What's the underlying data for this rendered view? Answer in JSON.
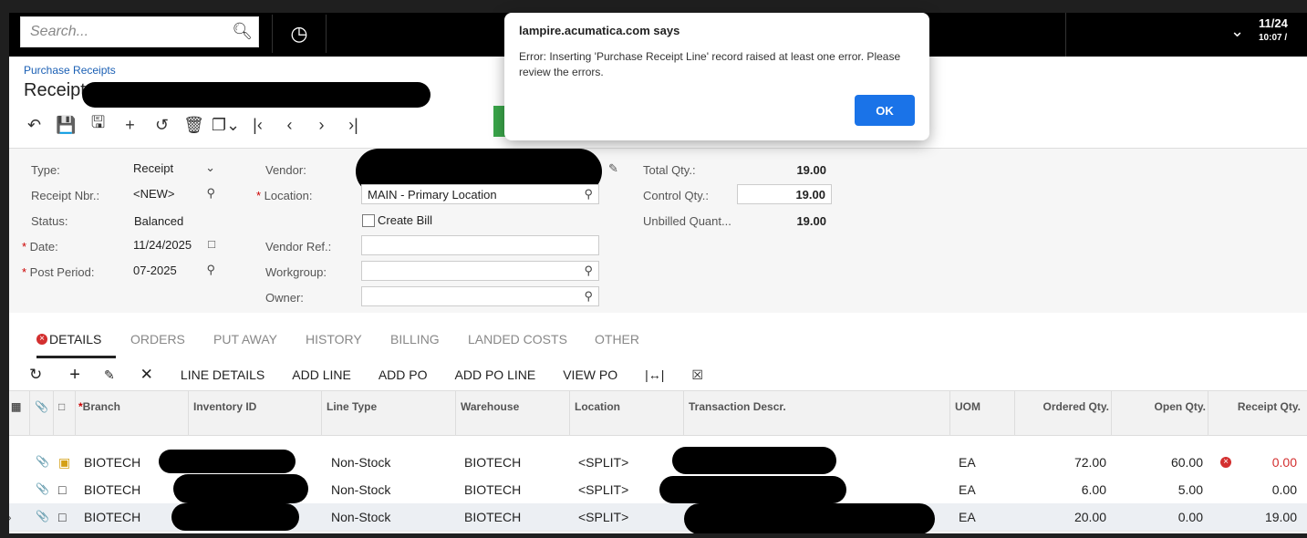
{
  "search": {
    "placeholder": "Search..."
  },
  "topbar": {
    "date": "11/24",
    "time": "10:07 /"
  },
  "header": {
    "breadcrumb": "Purchase Receipts",
    "title": "Receipt"
  },
  "form": {
    "type_label": "Type:",
    "type_value": "Receipt",
    "receipt_nbr_label": "Receipt Nbr.:",
    "receipt_nbr_value": "<NEW>",
    "status_label": "Status:",
    "status_value": "Balanced",
    "date_label": "Date:",
    "date_value": "11/24/2025",
    "post_period_label": "Post Period:",
    "post_period_value": "07-2025",
    "vendor_label": "Vendor:",
    "location_label": "Location:",
    "location_value": "MAIN - Primary Location",
    "create_bill_label": "Create Bill",
    "vendor_ref_label": "Vendor Ref.:",
    "workgroup_label": "Workgroup:",
    "owner_label": "Owner:",
    "total_qty_label": "Total Qty.:",
    "total_qty_value": "19.00",
    "control_qty_label": "Control Qty.:",
    "control_qty_value": "19.00",
    "unbilled_label": "Unbilled Quant...",
    "unbilled_value": "19.00"
  },
  "tabs": [
    "DETAILS",
    "ORDERS",
    "PUT AWAY",
    "HISTORY",
    "BILLING",
    "LANDED COSTS",
    "OTHER"
  ],
  "grid_toolbar": [
    "LINE DETAILS",
    "ADD LINE",
    "ADD PO",
    "ADD PO LINE",
    "VIEW PO"
  ],
  "grid": {
    "headers": [
      "Branch",
      "Inventory ID",
      "Line Type",
      "Warehouse",
      "Location",
      "Transaction Descr.",
      "UOM",
      "Ordered Qty.",
      "Open Qty.",
      "Receipt Qty."
    ],
    "rows": [
      {
        "branch": "BIOTECH",
        "line_type": "Non-Stock",
        "warehouse": "BIOTECH",
        "location": "<SPLIT>",
        "uom": "EA",
        "ordered": "72.00",
        "open": "60.00",
        "receipt": "0.00"
      },
      {
        "branch": "BIOTECH",
        "line_type": "Non-Stock",
        "warehouse": "BIOTECH",
        "location": "<SPLIT>",
        "uom": "EA",
        "ordered": "6.00",
        "open": "5.00",
        "receipt": "0.00"
      },
      {
        "branch": "BIOTECH",
        "line_type": "Non-Stock",
        "warehouse": "BIOTECH",
        "location": "<SPLIT>",
        "uom": "EA",
        "ordered": "20.00",
        "open": "0.00",
        "receipt": "19.00"
      }
    ]
  },
  "dialog": {
    "title": "lampire.acumatica.com says",
    "message": "Error: Inserting  'Purchase Receipt Line' record raised at least one error. Please review the errors.",
    "ok_label": "OK"
  },
  "colors": {
    "accent": "#1a73e8",
    "error": "#d32f2f",
    "save_green": "#3aa64a"
  }
}
